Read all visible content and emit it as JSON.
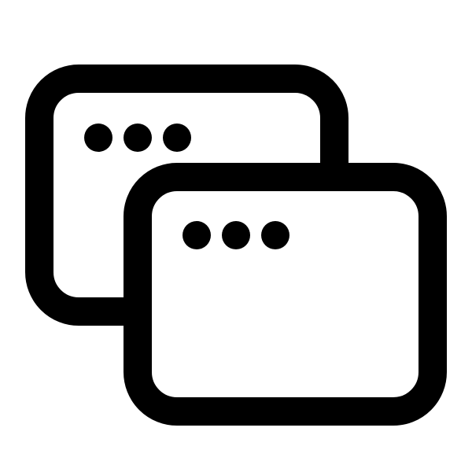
{
  "icon": {
    "name": "multiple-windows-icon",
    "stroke_color": "#000000",
    "fill_color": "#ffffff",
    "background_color": "#ffffff",
    "windows": [
      {
        "name": "back-window",
        "dots": 3
      },
      {
        "name": "front-window",
        "dots": 3
      }
    ]
  }
}
